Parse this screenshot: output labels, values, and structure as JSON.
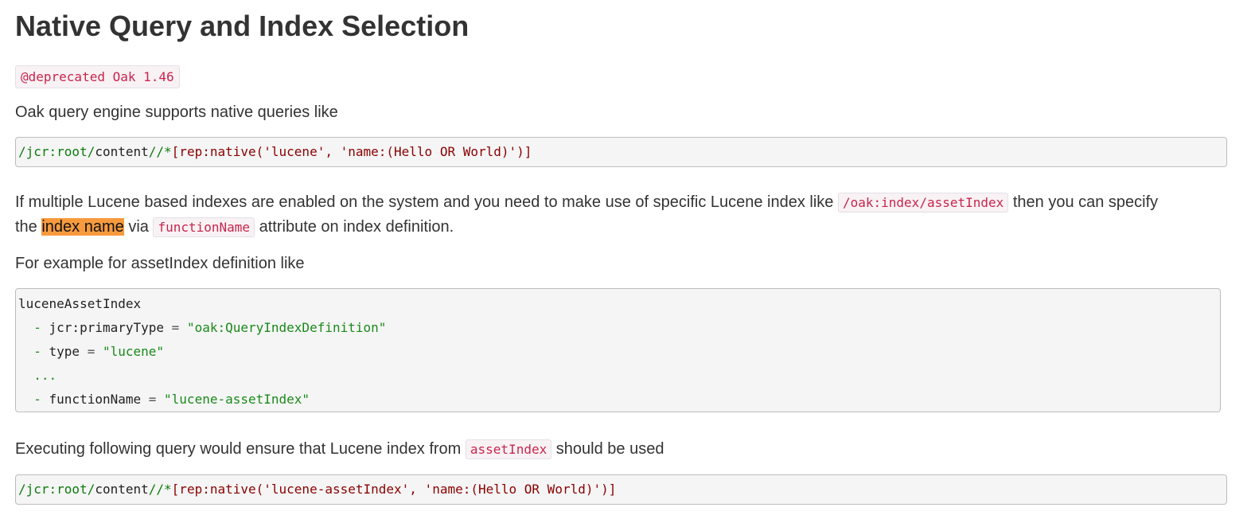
{
  "heading": "Native Query and Index Selection",
  "deprecated_badge": "@deprecated Oak 1.46",
  "intro_text": "Oak query engine supports native queries like",
  "query1": {
    "path_prefix": "/jcr:root/",
    "path_mid": "content",
    "path_suffix": "//*",
    "predicate": "[rep:native('lucene', 'name:(Hello OR World)')]"
  },
  "para2": {
    "part1": "If multiple Lucene based indexes are enabled on the system and you need to make use of specific Lucene index like ",
    "code_index_path": "/oak:index/assetIndex",
    "part2": " then you can specify",
    "line2_start": "the ",
    "highlight": "index name",
    "line2_mid": " via ",
    "code_function_name": "functionName",
    "line2_end": " attribute on index definition."
  },
  "example_intro": "For example for assetIndex definition like",
  "definition_block": {
    "line1": "luceneAssetIndex",
    "line2_dash": "  - ",
    "line2_key": "jcr:primaryType",
    "line2_eq": " = ",
    "line2_val": "\"oak:QueryIndexDefinition\"",
    "line3_dash": "  - ",
    "line3_key": "type",
    "line3_eq": " = ",
    "line3_val": "\"lucene\"",
    "line4": "  ...",
    "line5_dash": "  - ",
    "line5_key": "functionName",
    "line5_eq": " = ",
    "line5_val": "\"lucene-assetIndex\""
  },
  "para3": {
    "part1": "Executing following query would ensure that Lucene index from ",
    "code_asset_index": "assetIndex",
    "part2": " should be used"
  },
  "query2": {
    "path_prefix": "/jcr:root/",
    "path_mid": "content",
    "path_suffix": "//*",
    "predicate": "[rep:native('lucene-assetIndex', 'name:(Hello OR World)')]"
  },
  "colors": {
    "text": "#333333",
    "inline_code": "#c7254e",
    "highlight": "#f79a3e",
    "code_path": "#0d7b0d",
    "code_string": "#8b0000"
  }
}
